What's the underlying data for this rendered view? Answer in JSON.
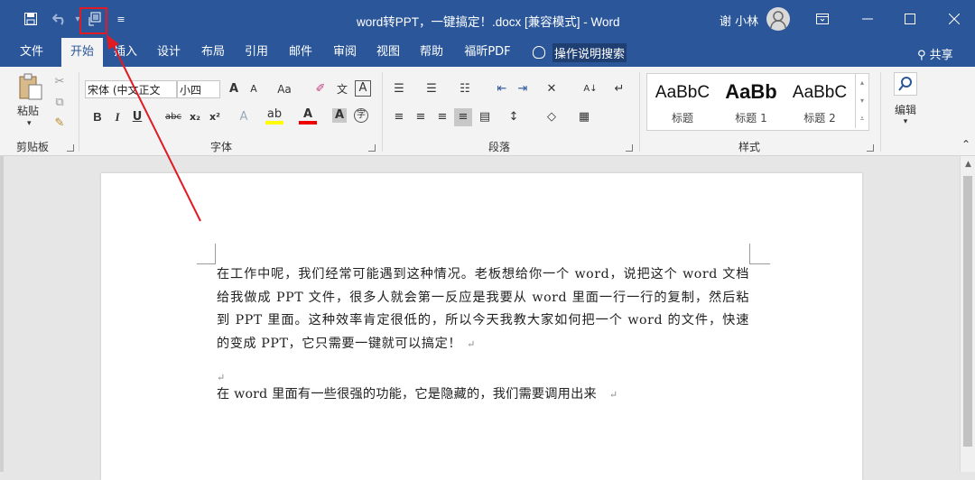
{
  "title_bar": {
    "title": "word转PPT，一键搞定！.docx [兼容模式] - Word",
    "user_name": "谢 小林",
    "icons": [
      "save-icon",
      "undo-icon",
      "touch-mode-icon",
      "customize-qat-icon",
      "ribbon-display-icon",
      "minimize-icon",
      "maximize-icon",
      "close-icon"
    ]
  },
  "tabs": [
    "文件",
    "开始",
    "插入",
    "设计",
    "布局",
    "引用",
    "邮件",
    "审阅",
    "视图",
    "帮助",
    "福昕PDF"
  ],
  "tell_me": "操作说明搜索",
  "share": "共享",
  "ribbon": {
    "clipboard": {
      "paste_label": "粘贴",
      "group_label": "剪贴板"
    },
    "font": {
      "font_name": "宋体 (中文正文",
      "font_size": "小四",
      "grow": "A",
      "shrink": "A",
      "change_case": "Aa",
      "phonetic": "文",
      "border": "A",
      "bold": "B",
      "italic": "I",
      "underline": "U",
      "strike": "abc",
      "subscript": "x₂",
      "superscript": "x²",
      "text_effects": "A",
      "font_color": "A",
      "shading": "A",
      "enclose": "字",
      "group_label": "字体"
    },
    "paragraph": {
      "group_label": "段落",
      "sort": "A↓"
    },
    "styles": {
      "items": [
        {
          "sample": "AaBbC",
          "name": "标题"
        },
        {
          "sample": "AaBb",
          "name": "标题 1"
        },
        {
          "sample": "AaBbC",
          "name": "标题 2"
        }
      ],
      "group_label": "样式"
    },
    "editing": {
      "label": "编辑"
    }
  },
  "document": {
    "paragraph1": "在工作中呢，我们经常可能遇到这种情况。老板想给你一个 word，说把这个 word 文档给我做成 PPT 文件，很多人就会第一反应是我要从 word 里面一行一行的复制，然后粘到 PPT 里面。这种效率肯定很低的，所以今天我教大家如何把一个 word 的文件，快速的变成 PPT，它只需要一键就可以搞定！",
    "paragraph2": "在 word 里面有一些很强的功能，它是隐藏的，我们需要调用出来",
    "para_mark": "↵"
  },
  "annotation_color": "#e01b24"
}
